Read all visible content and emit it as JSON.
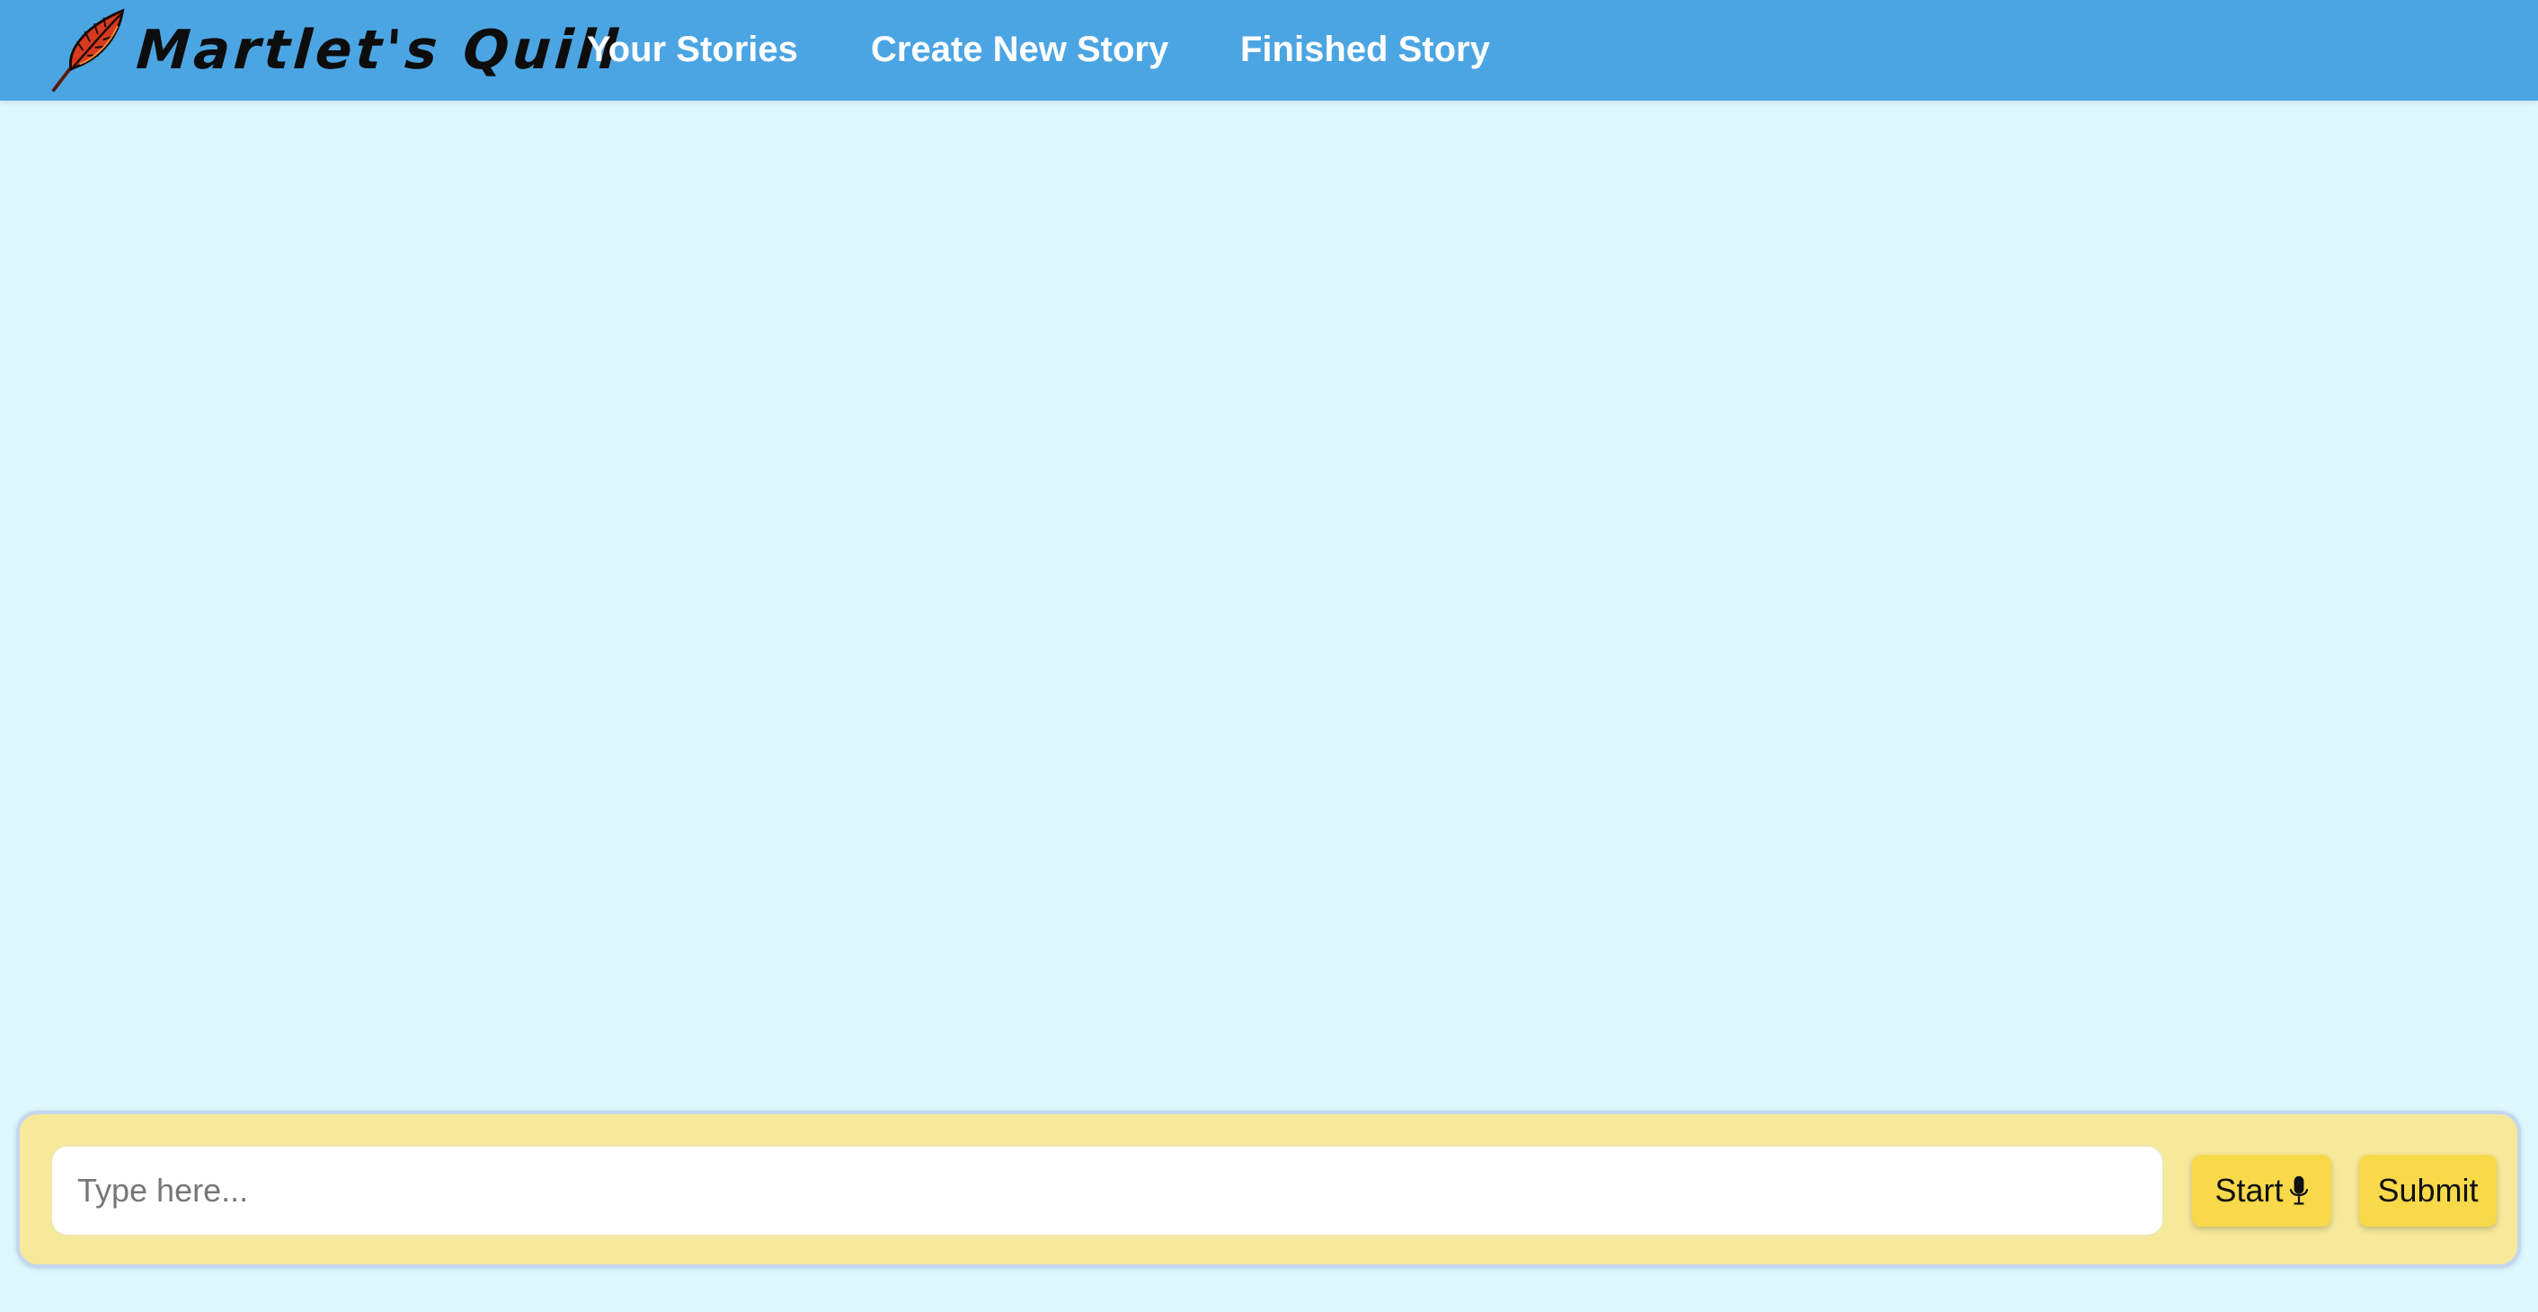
{
  "app": {
    "name": "Martlet's Quill",
    "logo_icon": "quill-feather-icon"
  },
  "nav": {
    "items": [
      {
        "label": "Your Stories"
      },
      {
        "label": "Create New Story"
      },
      {
        "label": "Finished Story"
      }
    ]
  },
  "composer": {
    "input_value": "",
    "input_placeholder": "Type here...",
    "start_label": "Start",
    "start_icon": "microphone-icon",
    "submit_label": "Submit"
  },
  "colors": {
    "header": "#4ca5e3",
    "background": "#dff8fd",
    "panel": "#f6e99a",
    "button": "#f8d949",
    "nav_text": "#ffffff"
  }
}
